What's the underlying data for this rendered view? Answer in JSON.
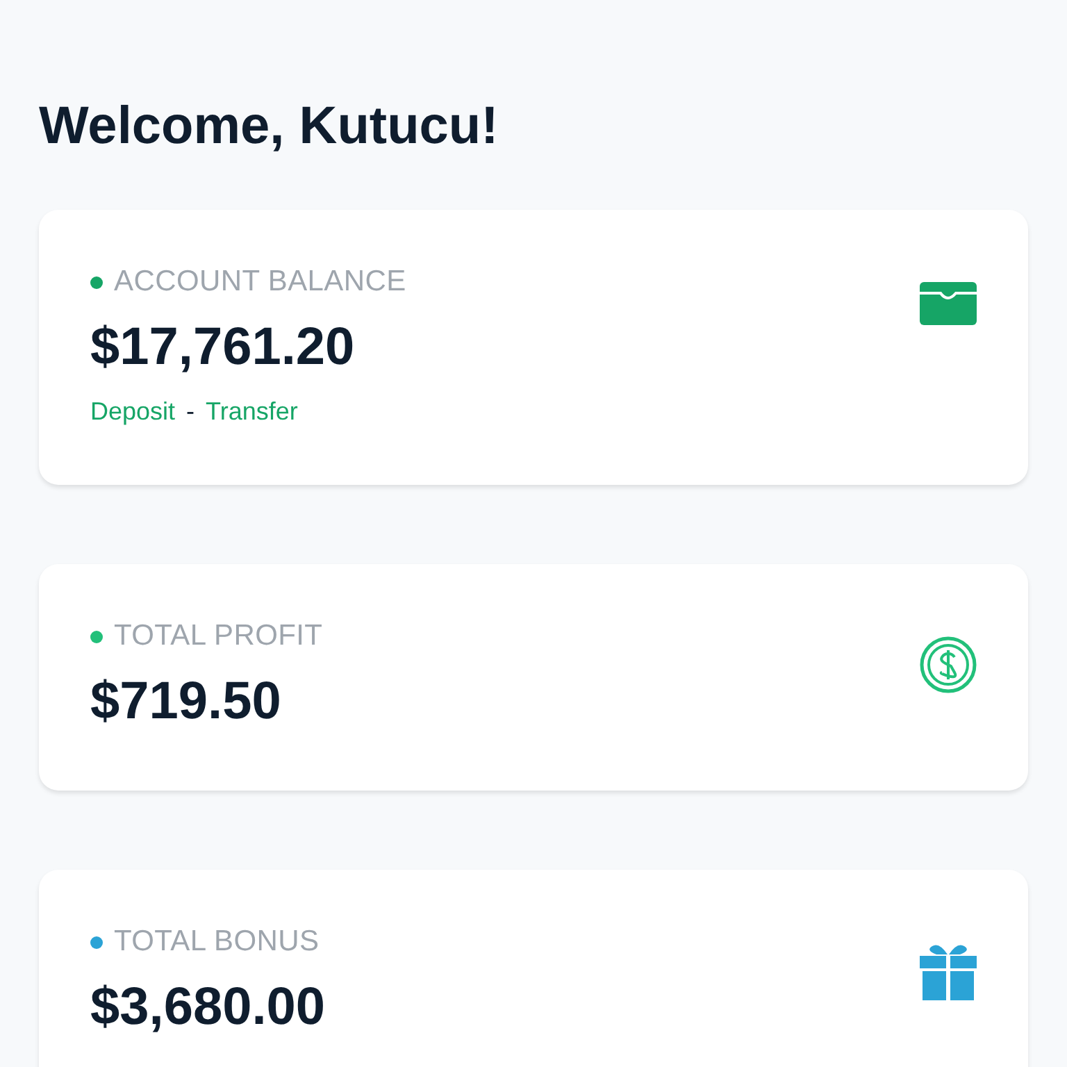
{
  "heading": "Welcome, Kutucu!",
  "cards": [
    {
      "kind": "wallet",
      "label": "ACCOUNT BALANCE",
      "color": "#16a566",
      "value": "$17,761.20",
      "links": [
        "Deposit",
        "Transfer"
      ],
      "separator": "-"
    },
    {
      "kind": "coin",
      "label": "TOTAL PROFIT",
      "color": "#22c07a",
      "value": "$719.50"
    },
    {
      "kind": "gift",
      "label": "TOTAL BONUS",
      "color": "#2ba3d6",
      "value": "$3,680.00"
    }
  ]
}
